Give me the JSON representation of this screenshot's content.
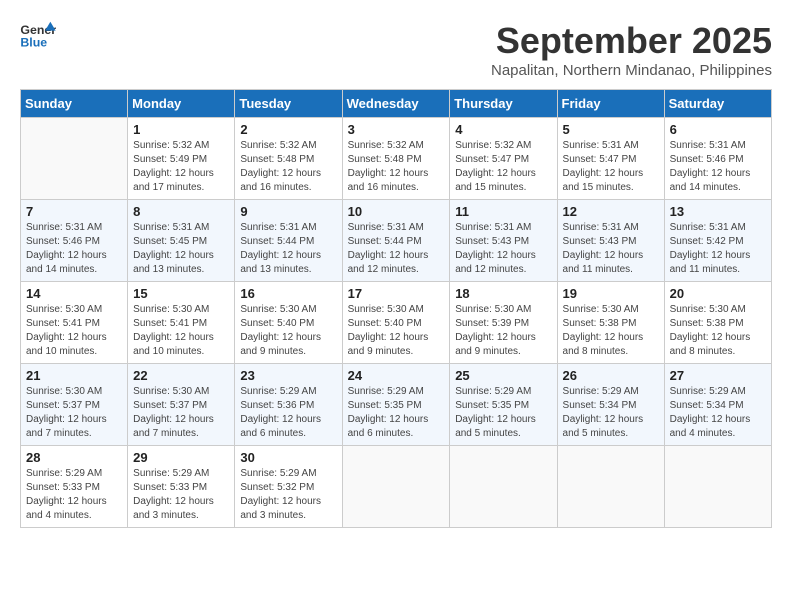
{
  "header": {
    "logo_line1": "General",
    "logo_line2": "Blue",
    "month_title": "September 2025",
    "location": "Napalitan, Northern Mindanao, Philippines"
  },
  "weekdays": [
    "Sunday",
    "Monday",
    "Tuesday",
    "Wednesday",
    "Thursday",
    "Friday",
    "Saturday"
  ],
  "weeks": [
    [
      {
        "num": "",
        "info": ""
      },
      {
        "num": "1",
        "info": "Sunrise: 5:32 AM\nSunset: 5:49 PM\nDaylight: 12 hours\nand 17 minutes."
      },
      {
        "num": "2",
        "info": "Sunrise: 5:32 AM\nSunset: 5:48 PM\nDaylight: 12 hours\nand 16 minutes."
      },
      {
        "num": "3",
        "info": "Sunrise: 5:32 AM\nSunset: 5:48 PM\nDaylight: 12 hours\nand 16 minutes."
      },
      {
        "num": "4",
        "info": "Sunrise: 5:32 AM\nSunset: 5:47 PM\nDaylight: 12 hours\nand 15 minutes."
      },
      {
        "num": "5",
        "info": "Sunrise: 5:31 AM\nSunset: 5:47 PM\nDaylight: 12 hours\nand 15 minutes."
      },
      {
        "num": "6",
        "info": "Sunrise: 5:31 AM\nSunset: 5:46 PM\nDaylight: 12 hours\nand 14 minutes."
      }
    ],
    [
      {
        "num": "7",
        "info": "Sunrise: 5:31 AM\nSunset: 5:46 PM\nDaylight: 12 hours\nand 14 minutes."
      },
      {
        "num": "8",
        "info": "Sunrise: 5:31 AM\nSunset: 5:45 PM\nDaylight: 12 hours\nand 13 minutes."
      },
      {
        "num": "9",
        "info": "Sunrise: 5:31 AM\nSunset: 5:44 PM\nDaylight: 12 hours\nand 13 minutes."
      },
      {
        "num": "10",
        "info": "Sunrise: 5:31 AM\nSunset: 5:44 PM\nDaylight: 12 hours\nand 12 minutes."
      },
      {
        "num": "11",
        "info": "Sunrise: 5:31 AM\nSunset: 5:43 PM\nDaylight: 12 hours\nand 12 minutes."
      },
      {
        "num": "12",
        "info": "Sunrise: 5:31 AM\nSunset: 5:43 PM\nDaylight: 12 hours\nand 11 minutes."
      },
      {
        "num": "13",
        "info": "Sunrise: 5:31 AM\nSunset: 5:42 PM\nDaylight: 12 hours\nand 11 minutes."
      }
    ],
    [
      {
        "num": "14",
        "info": "Sunrise: 5:30 AM\nSunset: 5:41 PM\nDaylight: 12 hours\nand 10 minutes."
      },
      {
        "num": "15",
        "info": "Sunrise: 5:30 AM\nSunset: 5:41 PM\nDaylight: 12 hours\nand 10 minutes."
      },
      {
        "num": "16",
        "info": "Sunrise: 5:30 AM\nSunset: 5:40 PM\nDaylight: 12 hours\nand 9 minutes."
      },
      {
        "num": "17",
        "info": "Sunrise: 5:30 AM\nSunset: 5:40 PM\nDaylight: 12 hours\nand 9 minutes."
      },
      {
        "num": "18",
        "info": "Sunrise: 5:30 AM\nSunset: 5:39 PM\nDaylight: 12 hours\nand 9 minutes."
      },
      {
        "num": "19",
        "info": "Sunrise: 5:30 AM\nSunset: 5:38 PM\nDaylight: 12 hours\nand 8 minutes."
      },
      {
        "num": "20",
        "info": "Sunrise: 5:30 AM\nSunset: 5:38 PM\nDaylight: 12 hours\nand 8 minutes."
      }
    ],
    [
      {
        "num": "21",
        "info": "Sunrise: 5:30 AM\nSunset: 5:37 PM\nDaylight: 12 hours\nand 7 minutes."
      },
      {
        "num": "22",
        "info": "Sunrise: 5:30 AM\nSunset: 5:37 PM\nDaylight: 12 hours\nand 7 minutes."
      },
      {
        "num": "23",
        "info": "Sunrise: 5:29 AM\nSunset: 5:36 PM\nDaylight: 12 hours\nand 6 minutes."
      },
      {
        "num": "24",
        "info": "Sunrise: 5:29 AM\nSunset: 5:35 PM\nDaylight: 12 hours\nand 6 minutes."
      },
      {
        "num": "25",
        "info": "Sunrise: 5:29 AM\nSunset: 5:35 PM\nDaylight: 12 hours\nand 5 minutes."
      },
      {
        "num": "26",
        "info": "Sunrise: 5:29 AM\nSunset: 5:34 PM\nDaylight: 12 hours\nand 5 minutes."
      },
      {
        "num": "27",
        "info": "Sunrise: 5:29 AM\nSunset: 5:34 PM\nDaylight: 12 hours\nand 4 minutes."
      }
    ],
    [
      {
        "num": "28",
        "info": "Sunrise: 5:29 AM\nSunset: 5:33 PM\nDaylight: 12 hours\nand 4 minutes."
      },
      {
        "num": "29",
        "info": "Sunrise: 5:29 AM\nSunset: 5:33 PM\nDaylight: 12 hours\nand 3 minutes."
      },
      {
        "num": "30",
        "info": "Sunrise: 5:29 AM\nSunset: 5:32 PM\nDaylight: 12 hours\nand 3 minutes."
      },
      {
        "num": "",
        "info": ""
      },
      {
        "num": "",
        "info": ""
      },
      {
        "num": "",
        "info": ""
      },
      {
        "num": "",
        "info": ""
      }
    ]
  ]
}
